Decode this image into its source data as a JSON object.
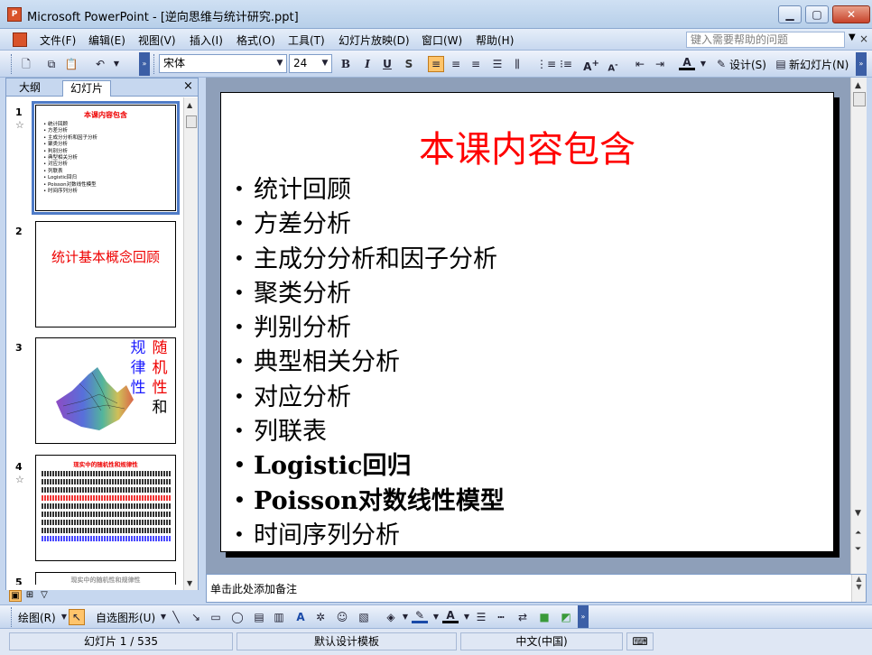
{
  "window": {
    "title": "Microsoft PowerPoint - [逆向思维与统计研究.ppt]",
    "app_icon": "powerpoint-icon"
  },
  "menu": {
    "items": [
      "文件(F)",
      "编辑(E)",
      "视图(V)",
      "插入(I)",
      "格式(O)",
      "工具(T)",
      "幻灯片放映(D)",
      "窗口(W)",
      "帮助(H)"
    ],
    "help_placeholder": "键入需要帮助的问题"
  },
  "toolbar": {
    "font_name": "宋体",
    "font_size": "24",
    "bold": "B",
    "italic": "I",
    "underline": "U",
    "shadow": "S",
    "design_label": "设计(S)",
    "new_slide_label": "新幻灯片(N)"
  },
  "pane": {
    "tab_outline": "大纲",
    "tab_slides": "幻灯片",
    "thumbnails": [
      {
        "num": "1",
        "starred": true,
        "title": "本课内容包含",
        "items": [
          "统计回顾",
          "方差分析",
          "主成分分析和因子分析",
          "聚类分析",
          "判别分析",
          "典型相关分析",
          "对应分析",
          "列联表",
          "Logistic回归",
          "Poisson对数线性模型",
          "时间序列分析"
        ]
      },
      {
        "num": "2",
        "starred": false,
        "text": "统计基本概念回顾"
      },
      {
        "num": "3",
        "starred": false,
        "col1": [
          "规",
          "律",
          "性"
        ],
        "col2": [
          "随",
          "机",
          "性",
          "和"
        ]
      },
      {
        "num": "4",
        "starred": true,
        "title": "现实中的随机性和规律性"
      },
      {
        "num": "5",
        "starred": false,
        "title": "现实中的随机性和规律性"
      }
    ]
  },
  "slide": {
    "title": "本课内容包含",
    "title_color": "#ff0000",
    "bullets": [
      "统计回顾",
      "方差分析",
      "主成分分析和因子分析",
      "聚类分析",
      "判别分析",
      "典型相关分析",
      "对应分析",
      "列联表",
      "Logistic回归",
      "Poisson对数线性模型",
      "时间序列分析"
    ]
  },
  "notes": {
    "placeholder": "单击此处添加备注"
  },
  "drawbar": {
    "draw_label": "绘图(R)",
    "autoshapes_label": "自选图形(U)"
  },
  "status": {
    "slide_pos": "幻灯片 1 / 535",
    "template": "默认设计模板",
    "language": "中文(中国)"
  }
}
